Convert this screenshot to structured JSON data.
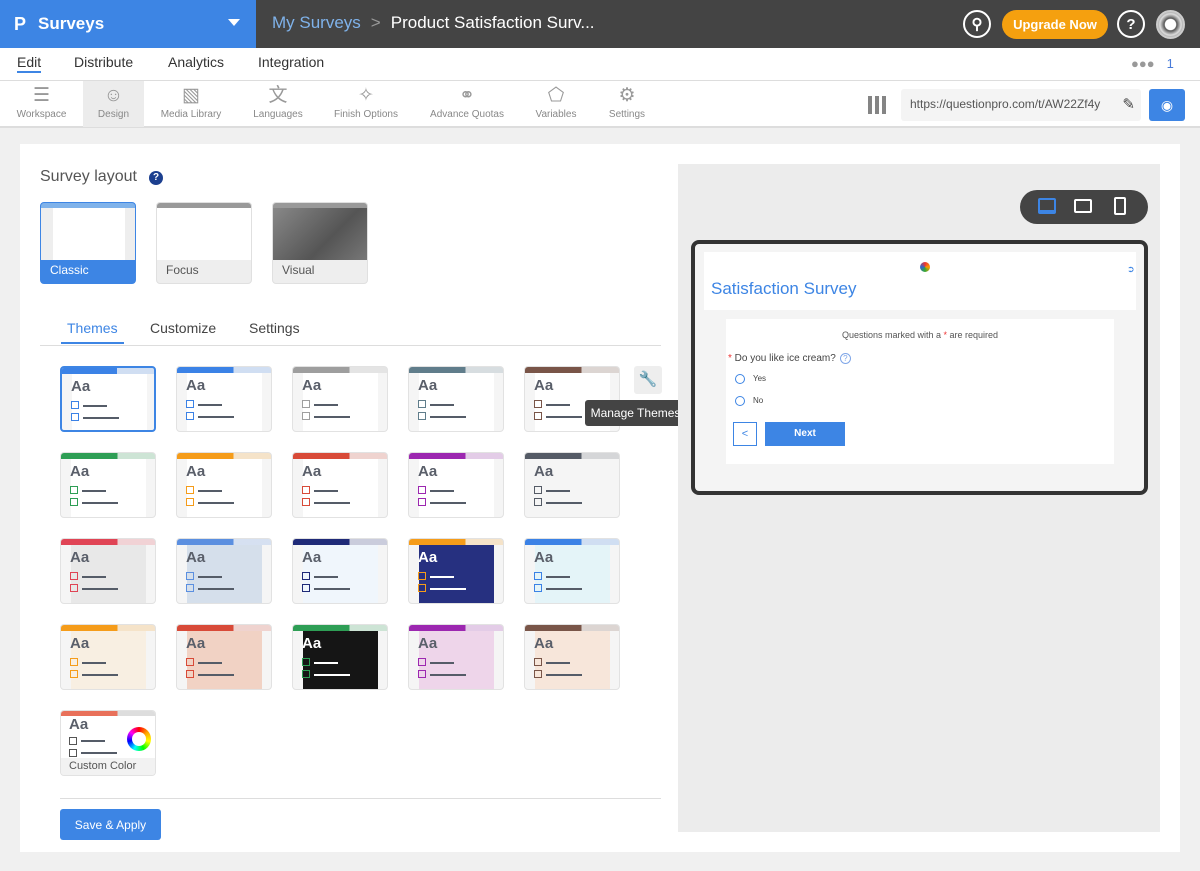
{
  "header": {
    "app_name": "Surveys",
    "breadcrumb_parent": "My Surveys",
    "breadcrumb_sep": ">",
    "survey_title": "Product Satisfaction Surv...",
    "upgrade_label": "Upgrade Now",
    "search_icon": "⚲",
    "help_icon": "?"
  },
  "nav": {
    "items": [
      "Edit",
      "Distribute",
      "Analytics",
      "Integration"
    ],
    "active": "Edit",
    "collaborators_count": "1"
  },
  "toolbar": {
    "items": [
      {
        "label": "Workspace",
        "icon": "☰"
      },
      {
        "label": "Design",
        "icon": "☺"
      },
      {
        "label": "Media Library",
        "icon": "▧"
      },
      {
        "label": "Languages",
        "icon": "文"
      },
      {
        "label": "Finish Options",
        "icon": "✧"
      },
      {
        "label": "Advance Quotas",
        "icon": "⚭"
      },
      {
        "label": "Variables",
        "icon": "⬠"
      },
      {
        "label": "Settings",
        "icon": "⚙"
      }
    ],
    "active": "Design",
    "survey_url": "https://questionpro.com/t/AW22Zf4y"
  },
  "layout": {
    "title": "Survey layout",
    "help": "?",
    "options": [
      "Classic",
      "Focus",
      "Visual"
    ],
    "selected": "Classic"
  },
  "subtabs": {
    "items": [
      "Themes",
      "Customize",
      "Settings"
    ],
    "active": "Themes"
  },
  "themes": [
    {
      "accent": "#3b82e6",
      "inner": "#ffffff",
      "selected": true
    },
    {
      "accent": "#3b82e6",
      "inner": "#ffffff"
    },
    {
      "accent": "#9e9e9e",
      "inner": "#ffffff"
    },
    {
      "accent": "#607d8b",
      "inner": "#ffffff"
    },
    {
      "accent": "#795548",
      "inner": "#ffffff"
    },
    {
      "accent": "#2e9e55",
      "inner": "#ffffff"
    },
    {
      "accent": "#f59c1a",
      "inner": "#ffffff"
    },
    {
      "accent": "#d84a38",
      "inner": "#ffffff"
    },
    {
      "accent": "#9c27b0",
      "inner": "#ffffff"
    },
    {
      "accent": "#555b66",
      "inner": "#f5f5f5"
    },
    {
      "accent": "#e04455",
      "inner": "#e8e8e8"
    },
    {
      "accent": "#5b8fe0",
      "inner": "#d5dfeb"
    },
    {
      "accent": "#1f2a78",
      "inner": "#f0f6fc"
    },
    {
      "accent": "#f59c1a",
      "stripe": "#f59c1a",
      "inner": "#263080",
      "dark": true
    },
    {
      "accent": "#3b82e6",
      "inner": "#e4f4f8"
    },
    {
      "accent": "#f59c1a",
      "inner": "#f8efe2"
    },
    {
      "accent": "#d84a38",
      "inner": "#f1d2c4"
    },
    {
      "accent": "#2e9e55",
      "inner": "#151515",
      "dark": true
    },
    {
      "accent": "#9c27b0",
      "inner": "#eed5ea"
    },
    {
      "accent": "#795548",
      "inner": "#f7e6da"
    }
  ],
  "manage_themes": {
    "tooltip": "Manage Themes"
  },
  "custom_color": {
    "label": "Custom Color",
    "accent": "#e8705a"
  },
  "save_label": "Save & Apply",
  "preview": {
    "title": "Satisfaction Survey",
    "required_note_pre": "Questions marked with a ",
    "required_note_star": "*",
    "required_note_post": " are required",
    "question": "Do you like ice cream?",
    "options": [
      "Yes",
      "No"
    ],
    "back_label": "<",
    "next_label": "Next"
  },
  "colors": {
    "brand": "#3d85e4",
    "topbar": "#444444",
    "upgrade": "#f5a00f"
  }
}
